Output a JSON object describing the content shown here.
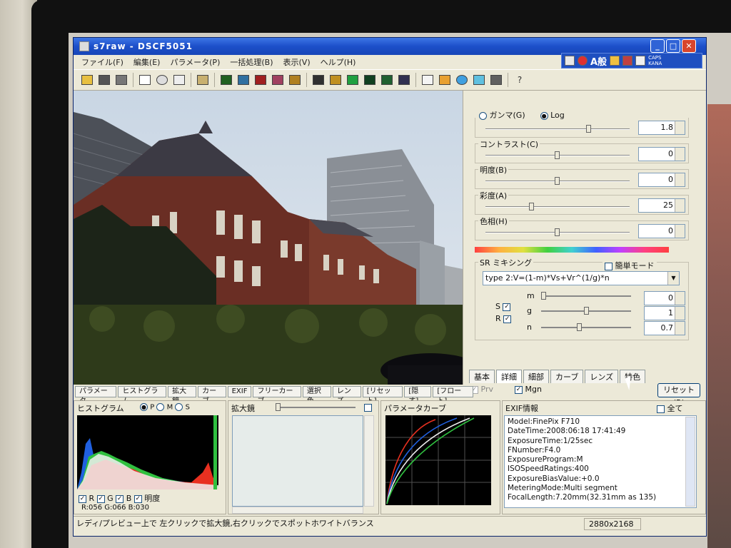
{
  "window": {
    "title": "s7raw - DSCF5051",
    "minimize": "_",
    "maximize": "□",
    "close": "✕"
  },
  "ime": {
    "mode": "A般",
    "caps": "CAPS",
    "kana": "KANA"
  },
  "menu": [
    "ファイル(F)",
    "編集(E)",
    "パラメータ(P)",
    "一括処理(B)",
    "表示(V)",
    "ヘルプ(H)"
  ],
  "toolbar": {
    "help": "?"
  },
  "adjust": {
    "gamma_label": "ガンマ(G)",
    "log_label": "Log",
    "gamma_value": "1.8",
    "contrast_label": "コントラスト(C)",
    "contrast_value": "0",
    "brightness_label": "明度(B)",
    "brightness_value": "0",
    "saturation_label": "彩度(A)",
    "saturation_value": "25",
    "hue_label": "色相(H)",
    "hue_value": "0"
  },
  "sr": {
    "title": "SR ミキシング",
    "simple_mode": "簡単モード",
    "formula": "type 2:V=(1-m)*Vs+Vr^(1/g)*n",
    "s_label": "S",
    "r_label": "R",
    "m_label": "m",
    "m_value": "0",
    "g_label": "g",
    "g_value": "1",
    "n_label": "n",
    "n_value": "0.7"
  },
  "tabs": [
    "基本",
    "詳細",
    "細部",
    "カーブ",
    "レンズ",
    "特色"
  ],
  "options": {
    "prv": "Prv",
    "mgn": "Mgn",
    "reset": "リセット(R)"
  },
  "bottom_tabs": [
    "パラメータ",
    "ヒストグラム",
    "拡大鏡",
    "カーブ",
    "EXIF",
    "フリーカーブ",
    "選択色",
    "レンズ",
    "[リセット]",
    "[隠す]",
    "[フロート]"
  ],
  "histogram": {
    "title": "ヒストグラム",
    "opt_p": "P",
    "opt_m": "M",
    "opt_s": "S",
    "r": "R",
    "g": "G",
    "b": "B",
    "luma": "明度",
    "readout": "R:056 G:066 B:030",
    "colors": {
      "red": "#e83020",
      "green": "#30c040",
      "blue": "#2060e0",
      "luma": "#f0f0f0"
    }
  },
  "magnifier": {
    "title": "拡大鏡"
  },
  "curve": {
    "title": "パラメータカーブ"
  },
  "exif": {
    "title": "EXIF情報",
    "all": "全て",
    "lines": [
      "Model:FinePix F710",
      "DateTime:2008:06:18 17:41:49",
      "ExposureTime:1/25sec",
      "FNumber:F4.0",
      "ExposureProgram:M",
      "ISOSpeedRatings:400",
      "ExposureBiasValue:+0.0",
      "MeteringMode:Multi segment",
      "FocalLength:7.20mm(32.31mm as 135)"
    ]
  },
  "status": {
    "hint": "レディ/プレビュー上で 左クリックで拡大鏡,右クリックでスポットホワイトバランス",
    "resolution": "2880x2168"
  }
}
